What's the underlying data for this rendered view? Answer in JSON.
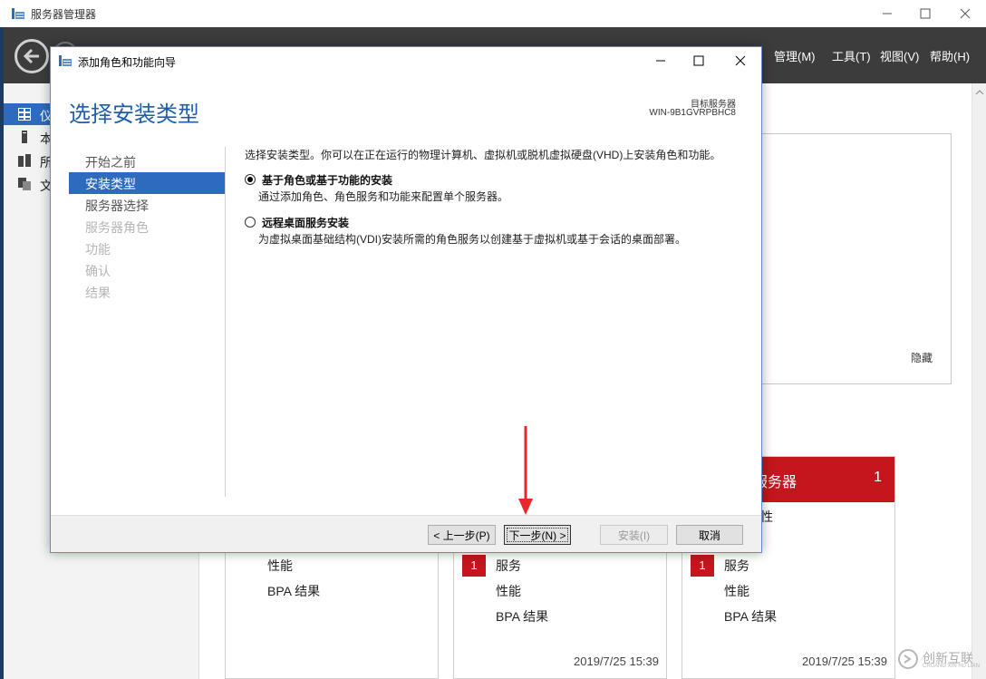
{
  "app": {
    "title": "服务器管理器",
    "menu": [
      "管理(M)",
      "工具(T)",
      "视图(V)",
      "帮助(H)"
    ]
  },
  "sidebar": {
    "items": [
      {
        "label": "仪",
        "icon": "dashboard-icon"
      },
      {
        "label": "本",
        "icon": "local-server-icon"
      },
      {
        "label": "所",
        "icon": "all-servers-icon"
      },
      {
        "label": "文",
        "icon": "file-services-icon"
      }
    ]
  },
  "welcome_panel": {
    "hide_label": "隐藏"
  },
  "tiles": [
    {
      "rows": [
        "性能",
        "BPA 结果"
      ],
      "badge": "",
      "timestamp": ""
    },
    {
      "rows": [
        "服务",
        "性能",
        "BPA 结果"
      ],
      "badge": "1",
      "timestamp": "2019/7/25 15:39"
    },
    {
      "title": "服务器",
      "count": "1",
      "partial_row": "性",
      "rows": [
        "服务",
        "性能",
        "BPA 结果"
      ],
      "badge": "1",
      "timestamp": "2019/7/25 15:39"
    }
  ],
  "wizard": {
    "title": "添加角色和功能向导",
    "heading": "选择安装类型",
    "target_label": "目标服务器",
    "target_value": "WIN-9B1GVRPBHC8",
    "nav": [
      {
        "label": "开始之前",
        "state": "normal"
      },
      {
        "label": "安装类型",
        "state": "active"
      },
      {
        "label": "服务器选择",
        "state": "normal"
      },
      {
        "label": "服务器角色",
        "state": "disabled"
      },
      {
        "label": "功能",
        "state": "disabled"
      },
      {
        "label": "确认",
        "state": "disabled"
      },
      {
        "label": "结果",
        "state": "disabled"
      }
    ],
    "intro": "选择安装类型。你可以在正在运行的物理计算机、虚拟机或脱机虚拟硬盘(VHD)上安装角色和功能。",
    "options": [
      {
        "title": "基于角色或基于功能的安装",
        "desc": "通过添加角色、角色服务和功能来配置单个服务器。",
        "checked": true
      },
      {
        "title": "远程桌面服务安装",
        "desc": "为虚拟桌面基础结构(VDI)安装所需的角色服务以创建基于虚拟机或基于会话的桌面部署。",
        "checked": false
      }
    ],
    "buttons": {
      "prev": "< 上一步(P)",
      "next": "下一步(N) >",
      "install": "安装(I)",
      "cancel": "取消"
    }
  },
  "colors": {
    "accent": "#2e6bbf",
    "heading": "#1e5eaa",
    "alert": "#c4161c",
    "header_bg": "#3c3c3c",
    "annotation_arrow": "#e8282b"
  },
  "watermark": {
    "text": "创新互联",
    "sub": "CHUANG XIN HU LIAN"
  }
}
